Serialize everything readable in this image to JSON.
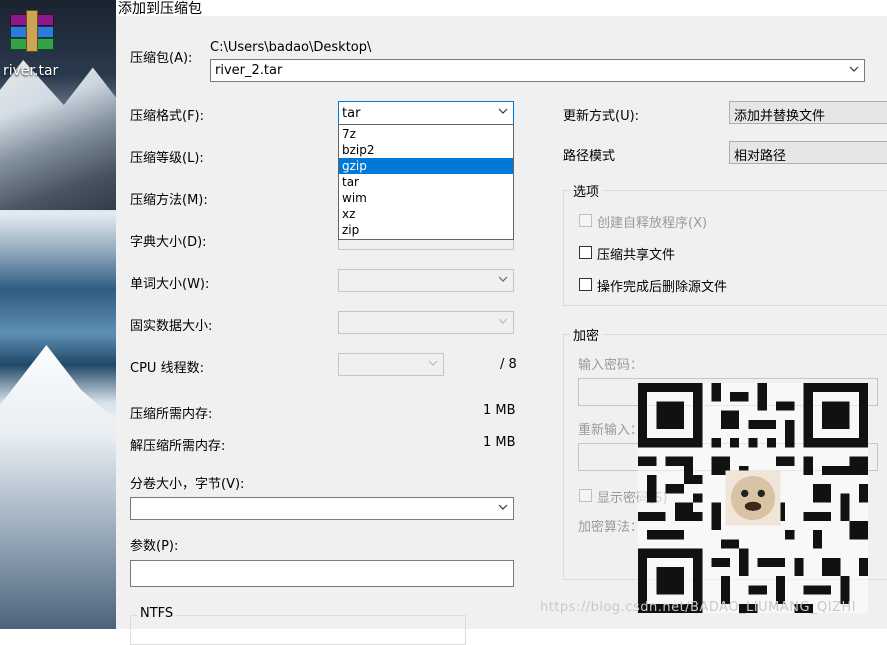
{
  "desktop": {
    "icon_label": "river.tar"
  },
  "dialog": {
    "title": "添加到压缩包",
    "archive_label": "压缩包(A):",
    "archive_path": "C:\\Users\\badao\\Desktop\\",
    "archive_name": "river_2.tar",
    "format_label": "压缩格式(F):",
    "format_value": "tar",
    "format_options": [
      "7z",
      "bzip2",
      "gzip",
      "tar",
      "wim",
      "xz",
      "zip"
    ],
    "format_highlighted": "gzip",
    "level_label": "压缩等级(L):",
    "method_label": "压缩方法(M):",
    "dict_label": "字典大小(D):",
    "word_label": "单词大小(W):",
    "solid_label": "固实数据大小:",
    "cpu_label": "CPU 线程数:",
    "cpu_max": "/ 8",
    "mem_compress_label": "压缩所需内存:",
    "mem_compress_value": "1 MB",
    "mem_decompress_label": "解压缩所需内存:",
    "mem_decompress_value": "1 MB",
    "volume_label": "分卷大小，字节(V):",
    "volume_value": "",
    "params_label": "参数(P):",
    "params_value": "",
    "ntfs_label": "NTFS",
    "update_label": "更新方式(U):",
    "update_value": "添加并替换文件",
    "pathmode_label": "路径模式",
    "pathmode_value": "相对路径",
    "options_title": "选项",
    "opt_sfx": "创建自释放程序(X)",
    "opt_shared": "压缩共享文件",
    "opt_delete": "操作完成后删除源文件",
    "encrypt_title": "加密",
    "pwd_label": "输入密码：",
    "pwd_reenter_label": "重新输入：",
    "show_pwd": "显示密码(S)",
    "enc_method_label": "加密算法：",
    "watermark": "https://blog.csdn.net/BADAO_LIUMANG_QIZHI"
  }
}
